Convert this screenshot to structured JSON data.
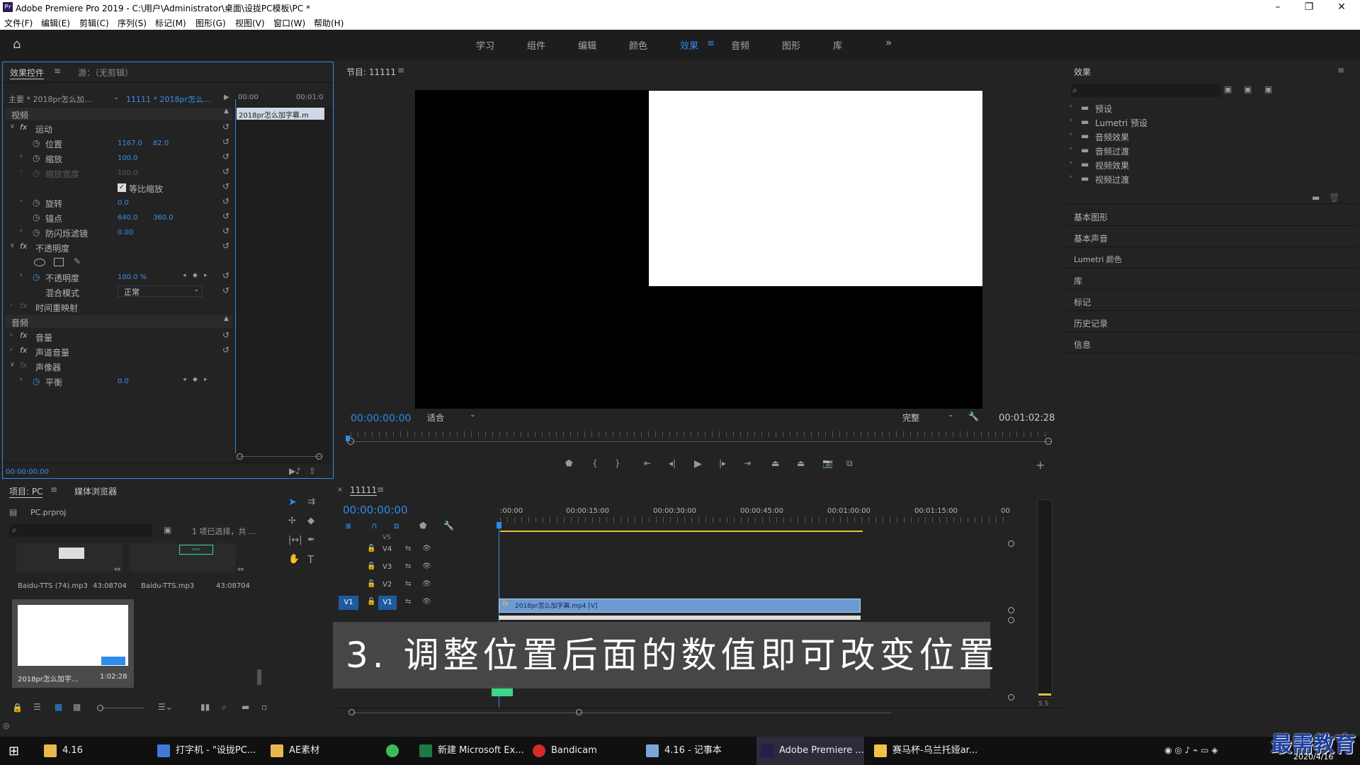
{
  "window": {
    "title": "Adobe Premiere Pro 2019 - C:\\用户\\Administrator\\桌面\\设拢PC模板\\PC *",
    "app_icon": "Pr"
  },
  "menu": [
    "文件(F)",
    "编辑(E)",
    "剪辑(C)",
    "序列(S)",
    "标记(M)",
    "图形(G)",
    "视图(V)",
    "窗口(W)",
    "帮助(H)"
  ],
  "workspaces": [
    "学习",
    "组件",
    "编辑",
    "颜色",
    "效果",
    "音频",
    "图形",
    "库"
  ],
  "workspace_active": "效果",
  "effect_controls": {
    "tab": "效果控件",
    "source_tab": "源：（无剪辑）",
    "master": "主要 * 2018pr怎么加...",
    "sequence": "11111 * 2018pr怎么...",
    "time_start": "00:00",
    "time_end": "00:01:0",
    "clip_name": "2018pr怎么加字幕.m",
    "video_header": "视频",
    "motion": "运动",
    "position_label": "位置",
    "position_x": "1167.0",
    "position_y": "82.0",
    "scale_label": "缩放",
    "scale_value": "100.0",
    "scale_width_label": "缩放宽度",
    "scale_width_value": "100.0",
    "uniform_scale": "等比缩放",
    "rotation_label": "旋转",
    "rotation_value": "0.0",
    "anchor_label": "锚点",
    "anchor_x": "640.0",
    "anchor_y": "360.0",
    "flicker_label": "防闪烁滤镜",
    "flicker_value": "0.00",
    "opacity_header": "不透明度",
    "opacity_label": "不透明度",
    "opacity_value": "100.0 %",
    "blend_label": "混合模式",
    "blend_value": "正常",
    "time_remap": "时间重映射",
    "audio_header": "音频",
    "volume": "音量",
    "channel_volume": "声道音量",
    "panner": "声像器",
    "balance_label": "平衡",
    "balance_value": "0.0",
    "timecode": "00:00:00:00"
  },
  "program_monitor": {
    "title": "节目: 11111",
    "timecode": "00:00:00:00",
    "fit": "适合",
    "quality": "完整",
    "duration": "00:01:02:28"
  },
  "effects_panel": {
    "title": "效果",
    "tree": [
      "预设",
      "Lumetri 预设",
      "音频效果",
      "音频过渡",
      "视频效果",
      "视频过渡"
    ],
    "sections": [
      "基本图形",
      "基本声音",
      "Lumetri 颜色",
      "库",
      "标记",
      "历史记录",
      "信息"
    ]
  },
  "project_panel": {
    "tab": "项目: PC",
    "media_tab": "媒体浏览器",
    "file": "PC.prproj",
    "selection_info": "1 项已选择，共 ...",
    "items": [
      {
        "name": "Baidu-TTS (74).mp3",
        "duration": "43:08704"
      },
      {
        "name": "Baidu-TTS.mp3",
        "duration": "43:08704"
      },
      {
        "name": "2018pr怎么加字...",
        "duration": "1:02:28"
      }
    ]
  },
  "timeline": {
    "tab": "11111",
    "timecode": "00:00:00:00",
    "ruler": [
      ":00:00",
      "00:00:15:00",
      "00:00:30:00",
      "00:00:45:00",
      "00:01:00:00",
      "00:01:15:00",
      "00"
    ],
    "tracks": [
      "V4",
      "V3",
      "V2",
      "V1"
    ],
    "clip_label": "2018pr怎么加字幕.mp4 [V]",
    "source_patch": "V1",
    "vs_label": "VS"
  },
  "caption": "3. 调整位置后面的数值即可改变位置",
  "watermark": {
    "brand": "最需教育",
    "date": "2020/4/16"
  },
  "taskbar": {
    "items": [
      "4.16",
      "打字机 - \"设拢PC...",
      "AE素材",
      "",
      "新建 Microsoft Ex...",
      "Bandicam",
      "4.16 - 记事本",
      "Adobe Premiere ...",
      "赛马杯-乌兰托娅ar..."
    ]
  },
  "colors": {
    "accent": "#2d8ceb",
    "clip": "#6c9bd6",
    "caption_bg": "#4a4a4a"
  }
}
